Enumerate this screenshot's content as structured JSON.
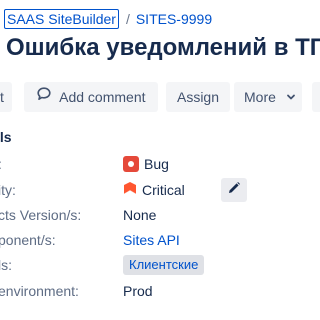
{
  "breadcrumb": {
    "project": "SAAS SiteBuilder",
    "separator": "/",
    "issue_key": "SITES-9999"
  },
  "issue": {
    "title": "Ошибка уведомлений в ТГ"
  },
  "toolbar": {
    "edit_label": "t",
    "comment_label": "Add comment",
    "assign_label": "Assign",
    "more_label": "More"
  },
  "details": {
    "section_title": "ils",
    "fields": {
      "type": {
        "label": ":",
        "value": "Bug",
        "icon": "bug-icon"
      },
      "priority": {
        "label": "ity:",
        "value": "Critical",
        "icon": "priority-critical-icon"
      },
      "affects_version": {
        "label": "cts Version/s:",
        "value": "None"
      },
      "components": {
        "label": "ponent/s:",
        "value": "Sites API"
      },
      "labels": {
        "label": "ls:",
        "value": "Клиентские"
      },
      "environment": {
        "label": "environment:",
        "value": "Prod"
      }
    }
  },
  "colors": {
    "link": "#0052cc",
    "text": "#172b4d",
    "muted": "#5e6c84",
    "bug": "#e5493a",
    "critical": "#ff5630"
  }
}
